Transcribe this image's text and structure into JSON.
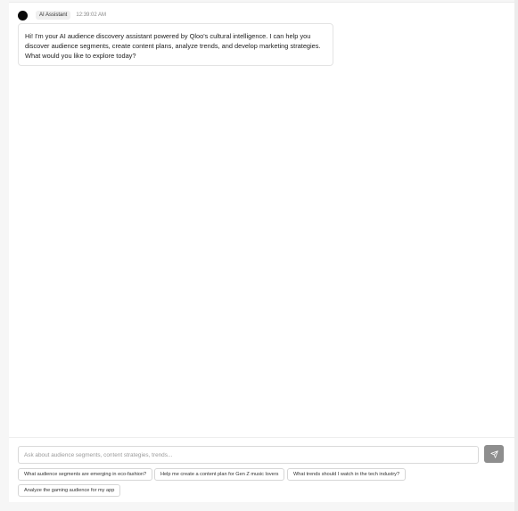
{
  "message": {
    "sender": "AI Assistant",
    "timestamp": "12:39:02 AM",
    "text": "Hi! I'm your AI audience discovery assistant powered by Qloo's cultural intelligence. I can help you discover audience segments, create content plans, analyze trends, and develop marketing strategies. What would you like to explore today?"
  },
  "composer": {
    "placeholder": "Ask about audience segments, content strategies, trends...",
    "value": ""
  },
  "suggestions": [
    "What audience segments are emerging in eco-fashion?",
    "Help me create a content plan for Gen Z music lovers",
    "What trends should I watch in the tech industry?",
    "Analyze the gaming audience for my app"
  ]
}
